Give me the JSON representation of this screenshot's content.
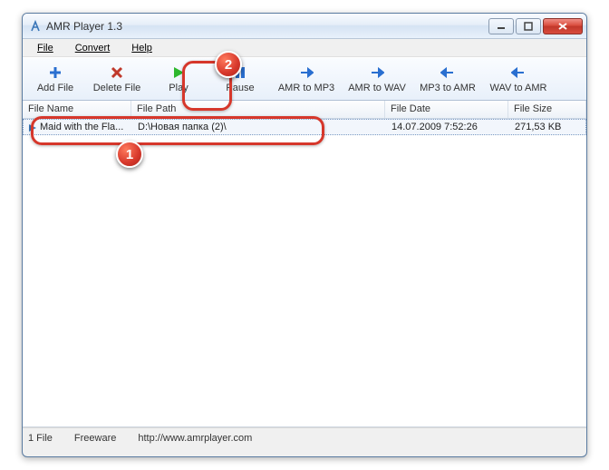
{
  "window": {
    "title": "AMR Player 1.3"
  },
  "menu": {
    "file": "File",
    "convert": "Convert",
    "help": "Help"
  },
  "toolbar": {
    "addfile": "Add File",
    "deletefile": "Delete File",
    "play": "Play",
    "pause": "Pause",
    "amr2mp3": "AMR to MP3",
    "amr2wav": "AMR to WAV",
    "mp32amr": "MP3 to AMR",
    "wav2amr": "WAV to AMR"
  },
  "columns": {
    "name": "File Name",
    "path": "File Path",
    "date": "File Date",
    "size": "File Size"
  },
  "rows": [
    {
      "name": "Maid with the Fla...",
      "path": "D:\\Новая папка (2)\\",
      "date": "14.07.2009 7:52:26",
      "size": "271,53 KB"
    }
  ],
  "status": {
    "count": "1 File",
    "license": "Freeware",
    "url": "http://www.amrplayer.com"
  },
  "annotations": {
    "b1": "1",
    "b2": "2"
  }
}
